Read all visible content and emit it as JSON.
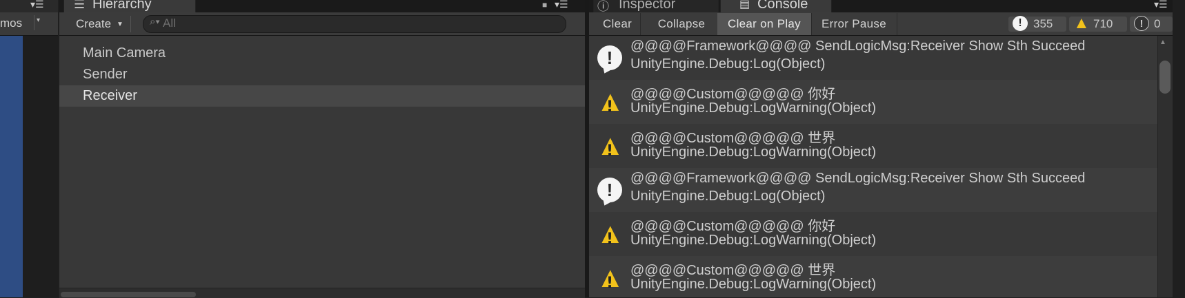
{
  "scene": {
    "gizmos_label": "mos",
    "menu_icon": "menu-icon"
  },
  "hierarchy": {
    "tab_label": "Hierarchy",
    "create_label": "Create",
    "search_placeholder": "All",
    "items": [
      {
        "label": "Main Camera",
        "selected": false
      },
      {
        "label": "Sender",
        "selected": false
      },
      {
        "label": "Receiver",
        "selected": true
      }
    ]
  },
  "tabs": {
    "inspector_label": "Inspector",
    "console_label": "Console"
  },
  "console": {
    "toolbar": {
      "clear": "Clear",
      "collapse": "Collapse",
      "clear_on_play": "Clear on Play",
      "error_pause": "Error Pause"
    },
    "counts": {
      "log": "355",
      "warning": "710",
      "error": "0"
    },
    "entries": [
      {
        "type": "info",
        "line1": "@@@@Framework@@@@ SendLogicMsg:Receiver Show Sth Succeed",
        "line2": "UnityEngine.Debug:Log(Object)"
      },
      {
        "type": "warning",
        "line1": "@@@@Custom@@@@@ 你好",
        "line2": "UnityEngine.Debug:LogWarning(Object)"
      },
      {
        "type": "warning",
        "line1": "@@@@Custom@@@@@ 世界",
        "line2": "UnityEngine.Debug:LogWarning(Object)"
      },
      {
        "type": "info",
        "line1": "@@@@Framework@@@@ SendLogicMsg:Receiver Show Sth Succeed",
        "line2": "UnityEngine.Debug:Log(Object)"
      },
      {
        "type": "warning",
        "line1": "@@@@Custom@@@@@ 你好",
        "line2": "UnityEngine.Debug:LogWarning(Object)"
      },
      {
        "type": "warning",
        "line1": "@@@@Custom@@@@@ 世界",
        "line2": "UnityEngine.Debug:LogWarning(Object)"
      }
    ]
  },
  "colors": {
    "scene_blue": "#2e4d84",
    "warning_yellow": "#f2c21b",
    "panel_bg": "#383838",
    "selected_bg": "#474747"
  }
}
